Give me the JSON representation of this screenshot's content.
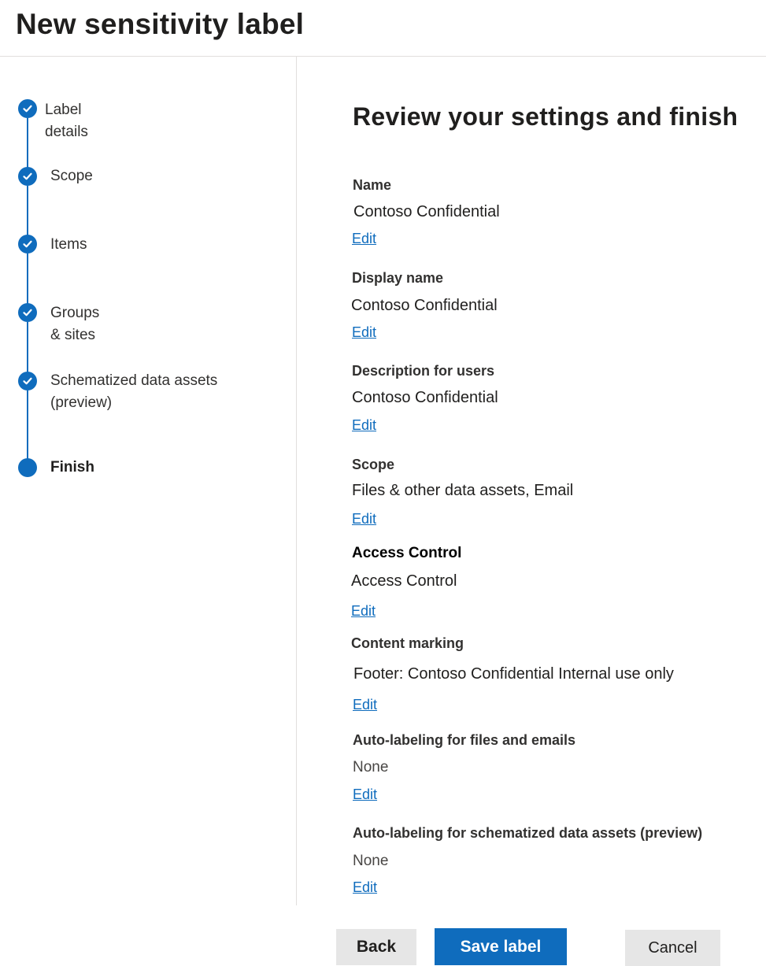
{
  "page": {
    "title": "New sensitivity label"
  },
  "steps": [
    {
      "label": "Label details",
      "status": "completed"
    },
    {
      "label": "Scope",
      "status": "completed"
    },
    {
      "label": "Items",
      "status": "completed"
    },
    {
      "label": "Groups & sites",
      "status": "completed"
    },
    {
      "label": "Schematized data assets (preview)",
      "status": "completed"
    },
    {
      "label": "Finish",
      "status": "current"
    }
  ],
  "main": {
    "heading": "Review your settings and finish",
    "sections": [
      {
        "label": "Name",
        "value": "Contoso Confidential",
        "edit": "Edit"
      },
      {
        "label": "Display name",
        "value": "Contoso Confidential",
        "edit": "Edit"
      },
      {
        "label": "Description for users",
        "value": "Contoso Confidential",
        "edit": "Edit"
      },
      {
        "label": "Scope",
        "value": "Files & other data assets, Email",
        "edit": "Edit"
      },
      {
        "label": "Access Control",
        "value": "Access Control",
        "edit": "Edit"
      },
      {
        "label": "Content marking",
        "value": "Footer: Contoso Confidential Internal use only",
        "edit": "Edit"
      },
      {
        "label": "Auto-labeling for files and emails",
        "value": "None",
        "edit": "Edit"
      },
      {
        "label": "Auto-labeling for schematized data assets (preview)",
        "value": "None",
        "edit": "Edit"
      }
    ]
  },
  "footer": {
    "back": "Back",
    "save": "Save label",
    "cancel": "Cancel"
  },
  "colors": {
    "accent": "#0f6cbd",
    "button_gray": "#e6e6e6"
  },
  "icons": {
    "completed_step": "checkmark-icon",
    "current_step": "current-step-dot"
  }
}
